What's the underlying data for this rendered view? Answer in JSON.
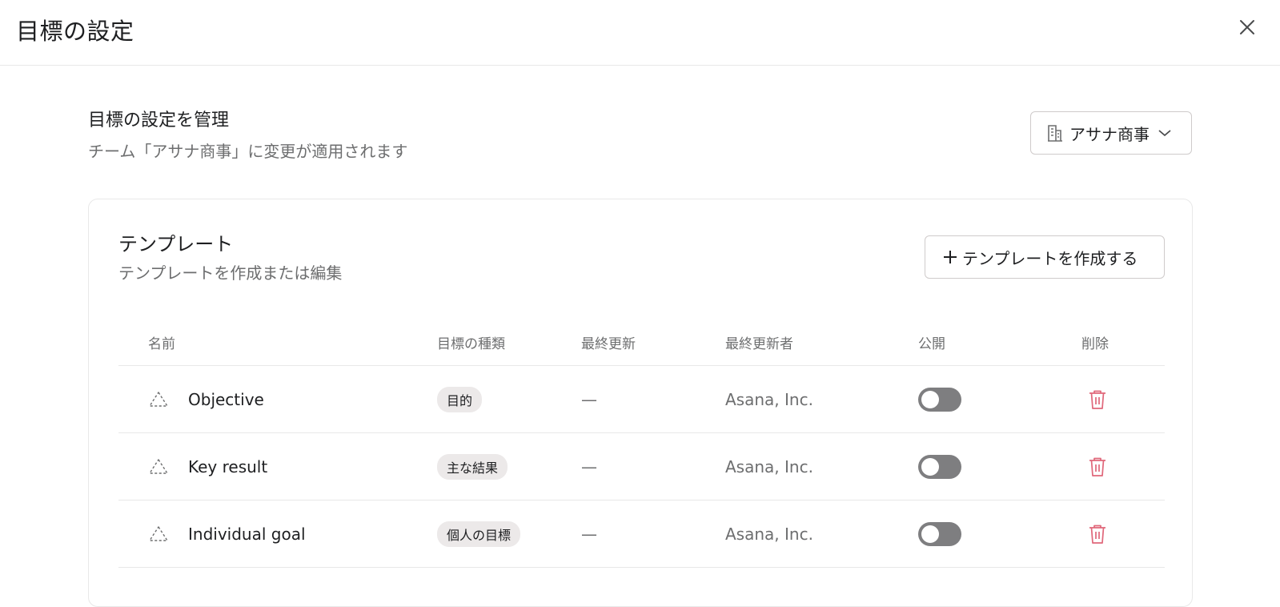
{
  "header": {
    "title": "目標の設定"
  },
  "settings": {
    "title": "目標の設定を管理",
    "subtitle": "チーム「アサナ商事」に変更が適用されます",
    "team_select": "アサナ商事"
  },
  "templates": {
    "title": "テンプレート",
    "subtitle": "テンプレートを作成または編集",
    "create_label": "テンプレートを作成する",
    "columns": {
      "name": "名前",
      "type": "目標の種類",
      "updated": "最終更新",
      "updated_by": "最終更新者",
      "public": "公開",
      "delete": "削除"
    },
    "rows": [
      {
        "name": "Objective",
        "type": "目的",
        "updated": "—",
        "updated_by": "Asana, Inc.",
        "public": false
      },
      {
        "name": "Key result",
        "type": "主な結果",
        "updated": "—",
        "updated_by": "Asana, Inc.",
        "public": false
      },
      {
        "name": "Individual goal",
        "type": "個人の目標",
        "updated": "—",
        "updated_by": "Asana, Inc.",
        "public": false
      }
    ]
  },
  "colors": {
    "delete_icon": "#e0677a",
    "toggle_off": "#7e7e80",
    "pill_bg": "#ece9e9"
  },
  "icons": {
    "close": "close-icon",
    "team": "building-icon",
    "dropdown": "chevron-down-icon",
    "add": "plus-icon",
    "goal": "dashed-triangle-icon",
    "delete": "trash-icon"
  }
}
